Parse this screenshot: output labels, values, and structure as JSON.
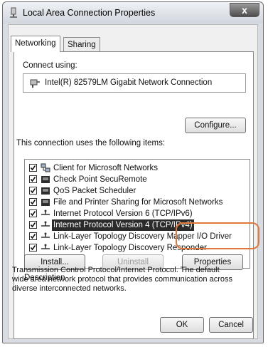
{
  "window": {
    "title": "Local Area Connection Properties",
    "close_label": "x"
  },
  "tabs": [
    {
      "label": "Networking"
    },
    {
      "label": "Sharing"
    }
  ],
  "connect_using": {
    "label": "Connect using:",
    "adapter": "Intel(R) 82579LM Gigabit Network Connection",
    "configure_label": "Configure..."
  },
  "items_label": "This connection uses the following items:",
  "items": [
    {
      "label": "Client for Microsoft Networks",
      "checked": true,
      "icon": "network-client-icon"
    },
    {
      "label": "Check Point SecuRemote",
      "checked": true,
      "icon": "network-service-icon"
    },
    {
      "label": "QoS Packet Scheduler",
      "checked": true,
      "icon": "network-service-icon"
    },
    {
      "label": "File and Printer Sharing for Microsoft Networks",
      "checked": true,
      "icon": "network-service-icon"
    },
    {
      "label": "Internet Protocol Version 6 (TCP/IPv6)",
      "checked": true,
      "icon": "protocol-icon"
    },
    {
      "label": "Internet Protocol Version 4 (TCP/IPv4)",
      "checked": true,
      "icon": "protocol-icon",
      "selected": true
    },
    {
      "label": "Link-Layer Topology Discovery Mapper I/O Driver",
      "checked": true,
      "icon": "protocol-icon"
    },
    {
      "label": "Link-Layer Topology Discovery Responder",
      "checked": true,
      "icon": "protocol-icon"
    }
  ],
  "buttons": {
    "install": "Install...",
    "uninstall": "Uninstall",
    "properties": "Properties",
    "ok": "OK",
    "cancel": "Cancel"
  },
  "description": {
    "label": "Description",
    "text": "Transmission Control Protocol/Internet Protocol. The default wide area network protocol that provides communication across diverse interconnected networks."
  },
  "colors": {
    "highlight_ring": "#e07a3c",
    "selection": "#2b2b2b"
  }
}
